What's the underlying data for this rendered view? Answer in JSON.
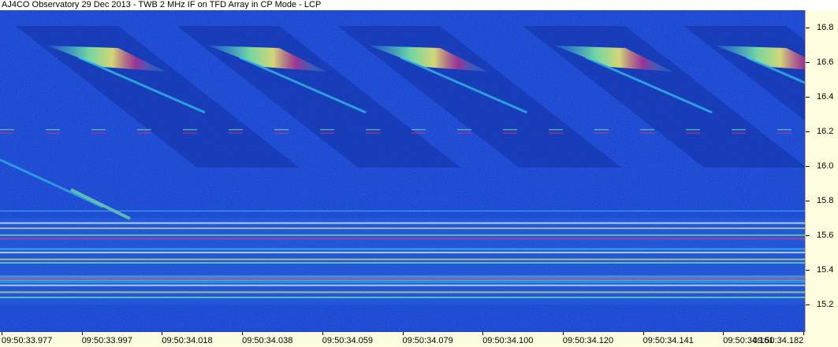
{
  "window": {
    "title": "AJ4CO Observatory 29 Dec 2013 - TWB 2 MHz IF on TFD Array in CP Mode - LCP"
  },
  "chart_data": {
    "type": "heatmap",
    "title": "AJ4CO Observatory 29 Dec 2013 - TWB 2 MHz IF on TFD Array in CP Mode - LCP",
    "xlabel": "",
    "ylabel": "",
    "x_ticks": [
      "09:50:33.977",
      "09:50:33.997",
      "09:50:34.018",
      "09:50:34.038",
      "09:50:34.059",
      "09:50:34.079",
      "09:50:34.100",
      "09:50:34.120",
      "09:50:34.141",
      "09:50:34.161",
      "09:50:34.182"
    ],
    "y_ticks": [
      15.2,
      15.4,
      15.6,
      15.8,
      16.0,
      16.2,
      16.4,
      16.6,
      16.8
    ],
    "ylim": [
      15.04,
      16.9
    ],
    "y_axis_side": "right",
    "colormap": [
      "#1020a0",
      "#1436c8",
      "#2a7ce0",
      "#35c8e8",
      "#7ee6a0",
      "#e8e870",
      "#f0a040",
      "#e03080"
    ],
    "features": {
      "emission_bursts_start_x": [
        0,
        0.2,
        0.4,
        0.63,
        0.83
      ],
      "interference_lines_mhz": [
        15.24,
        15.27,
        15.31,
        15.34,
        15.36,
        15.44,
        15.46,
        15.5,
        15.52,
        15.58,
        15.6,
        15.64,
        15.67,
        15.74,
        16.19,
        16.21
      ]
    }
  }
}
